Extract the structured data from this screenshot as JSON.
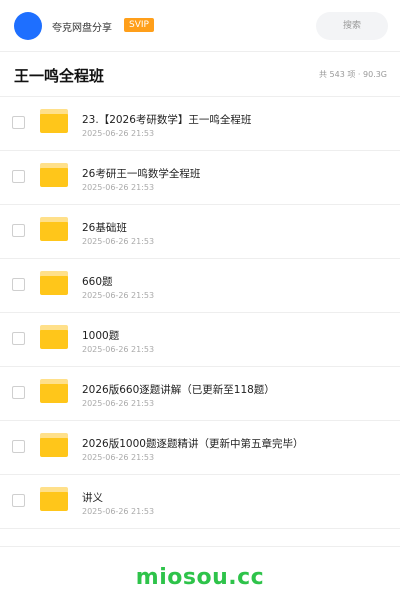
{
  "header": {
    "app_name": "夸克网盘分享",
    "badge": "SVIP",
    "search_placeholder": "搜索"
  },
  "title_bar": {
    "title": "王一鸣全程班",
    "summary": "共 543 项 · 90.3G"
  },
  "files": [
    {
      "name": "23.【2026考研数学】王一鸣全程班",
      "date": "2025-06-26 21:53"
    },
    {
      "name": "26考研王一鸣数学全程班",
      "date": "2025-06-26 21:53"
    },
    {
      "name": "26基础班",
      "date": "2025-06-26 21:53"
    },
    {
      "name": "660题",
      "date": "2025-06-26 21:53"
    },
    {
      "name": "1000题",
      "date": "2025-06-26 21:53"
    },
    {
      "name": "2026版660逐题讲解（已更新至118题）",
      "date": "2025-06-26 21:53"
    },
    {
      "name": "2026版1000题逐题精讲（更新中第五章完毕）",
      "date": "2025-06-26 21:53"
    },
    {
      "name": "讲义",
      "date": "2025-06-26 21:53"
    }
  ],
  "footer": {
    "brand": "miosou.cc"
  },
  "colors": {
    "accent": "#1e6fff",
    "badge": "#ff9f1a",
    "folder": "#ffc61a",
    "brand": "#2ec34a"
  }
}
